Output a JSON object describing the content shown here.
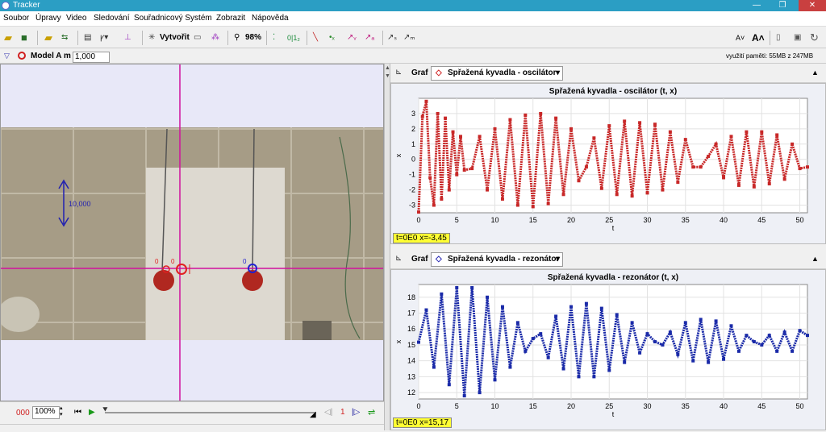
{
  "window": {
    "title": "Tracker",
    "minimize": "—",
    "maximize": "❐",
    "close": "✕"
  },
  "menu": [
    "Soubor",
    "Úpravy",
    "Video",
    "Sledování",
    "Souřadnicový Systém",
    "Zobrazit",
    "Nápověda"
  ],
  "toolbar": {
    "create_label": "Vytvořit",
    "zoom_label": "98%",
    "points_label": "0|1₂"
  },
  "trackbar": {
    "model_name": "Model A",
    "mass_label": "m",
    "mass_value": "1,000",
    "memory": "využití paměti: 55MB z 247MB"
  },
  "video": {
    "calibration_label": "10,000",
    "marker_left_label": "0",
    "marker_center_label": "0",
    "marker_right_label": "0"
  },
  "player": {
    "frame_counter": "000",
    "zoom_value": "100%",
    "step_size": "1"
  },
  "plots": [
    {
      "header_label": "Graf",
      "track_name": "Spřažená kyvadla - oscilátor",
      "readout": "t=0E0  x=-3,45",
      "chart_data": {
        "type": "line",
        "title": "Spřažená kyvadla - oscilátor (t, x)",
        "xlabel": "t",
        "ylabel": "x",
        "xlim": [
          0,
          51
        ],
        "ylim": [
          -3.5,
          4
        ],
        "xticks": [
          0,
          5,
          10,
          15,
          20,
          25,
          30,
          35,
          40,
          45,
          50
        ],
        "yticks": [
          -3,
          -2,
          -1,
          0,
          1,
          2,
          3
        ],
        "color": "#c82828",
        "series": [
          {
            "x": [
              0,
              0.5,
              1,
              1.5,
              2,
              2.5,
              3,
              3.5,
              4,
              4.5,
              5,
              5.5,
              6,
              7,
              8,
              9,
              10,
              11,
              12,
              13,
              14,
              15,
              16,
              17,
              18,
              19,
              20,
              21,
              22,
              23,
              24,
              25,
              26,
              27,
              28,
              29,
              30,
              31,
              32,
              33,
              34,
              35,
              36,
              37,
              38,
              39,
              40,
              41,
              42,
              43,
              44,
              45,
              46,
              47,
              48,
              49,
              50,
              51
            ],
            "y": [
              -3.45,
              2.8,
              3.8,
              -1.2,
              -3.0,
              3.0,
              -2.6,
              2.7,
              -2.0,
              1.8,
              -1.0,
              1.5,
              -0.7,
              -0.6,
              1.5,
              -2.0,
              2.0,
              -2.6,
              2.6,
              -3.0,
              2.9,
              -3.1,
              3.0,
              -2.9,
              2.7,
              -2.3,
              2.0,
              -1.4,
              -0.5,
              1.4,
              -1.9,
              2.2,
              -2.3,
              2.5,
              -2.4,
              2.4,
              -2.2,
              2.3,
              -2.0,
              1.8,
              -1.5,
              1.3,
              -0.5,
              -0.5,
              0.2,
              1.0,
              -1.2,
              1.5,
              -1.7,
              1.8,
              -1.8,
              1.8,
              -1.6,
              1.6,
              -1.3,
              1.0,
              -0.6,
              -0.5
            ]
          }
        ]
      }
    },
    {
      "header_label": "Graf",
      "track_name": "Spřažená kyvadla - rezonátor",
      "readout": "t=0E0  x=15,17",
      "chart_data": {
        "type": "line",
        "title": "Spřažená kyvadla - rezonátor (t, x)",
        "xlabel": "t",
        "ylabel": "x",
        "xlim": [
          0,
          51
        ],
        "ylim": [
          11.6,
          18.8
        ],
        "xticks": [
          0,
          5,
          10,
          15,
          20,
          25,
          30,
          35,
          40,
          45,
          50
        ],
        "yticks": [
          12,
          13,
          14,
          15,
          16,
          17,
          18
        ],
        "color": "#1a2aa8",
        "series": [
          {
            "x": [
              0,
              1,
              2,
              3,
              4,
              5,
              6,
              7,
              8,
              9,
              10,
              11,
              12,
              13,
              14,
              15,
              16,
              17,
              18,
              19,
              20,
              21,
              22,
              23,
              24,
              25,
              26,
              27,
              28,
              29,
              30,
              31,
              32,
              33,
              34,
              35,
              36,
              37,
              38,
              39,
              40,
              41,
              42,
              43,
              44,
              45,
              46,
              47,
              48,
              49,
              50,
              51
            ],
            "y": [
              15.17,
              17.2,
              13.6,
              18.2,
              12.5,
              18.6,
              11.8,
              18.6,
              12.0,
              18.0,
              12.8,
              17.4,
              13.6,
              16.4,
              14.6,
              15.4,
              15.7,
              14.2,
              16.8,
              13.5,
              17.4,
              13.0,
              17.6,
              13.0,
              17.3,
              13.4,
              16.9,
              13.9,
              16.4,
              14.5,
              15.7,
              15.2,
              15.0,
              15.8,
              14.4,
              16.4,
              14.0,
              16.6,
              13.9,
              16.5,
              14.1,
              16.2,
              14.6,
              15.6,
              15.2,
              15.0,
              15.6,
              14.6,
              15.8,
              14.6,
              15.9,
              15.6
            ]
          }
        ]
      }
    }
  ],
  "colors": {
    "oscillator": "#c82828",
    "resonator": "#1a2aa8",
    "axis_line": "#d0109e",
    "readout_bg": "#ffff33"
  }
}
